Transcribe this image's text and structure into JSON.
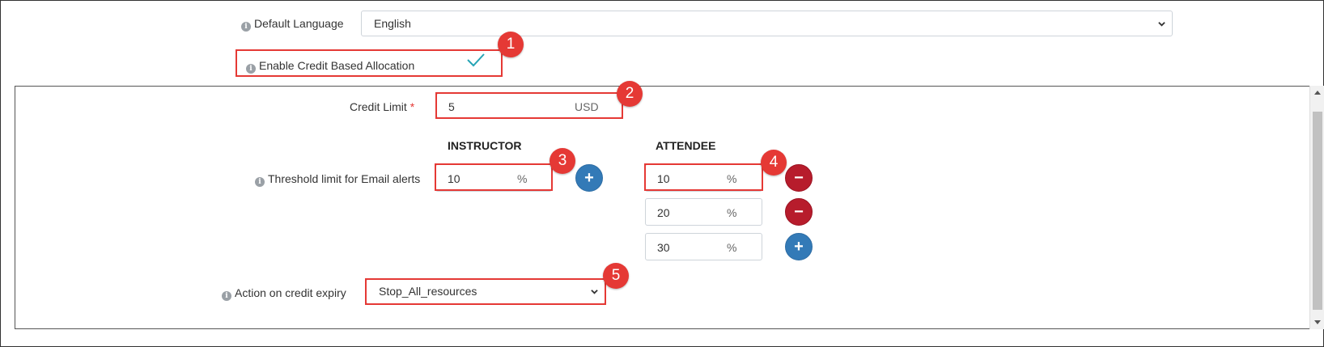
{
  "default_language": {
    "label": "Default Language",
    "value": "English"
  },
  "credit_allocation": {
    "label": "Enable Credit Based Allocation",
    "enabled": true
  },
  "credit_limit": {
    "label": "Credit Limit",
    "required_mark": "*",
    "value": "5",
    "unit": "USD"
  },
  "threshold": {
    "label": "Threshold limit for Email alerts",
    "instructor_header": "INSTRUCTOR",
    "attendee_header": "ATTENDEE",
    "instructor_value": "10",
    "attendee_values": [
      "10",
      "20",
      "30"
    ],
    "unit": "%",
    "add_symbol": "+",
    "remove_symbol": "−"
  },
  "credit_expiry": {
    "label": "Action on credit expiry",
    "value": "Stop_All_resources"
  },
  "callouts": [
    "1",
    "2",
    "3",
    "4",
    "5"
  ],
  "colors": {
    "highlight": "#e53935",
    "add_button": "#337ab7",
    "remove_button": "#b71c2c",
    "checkmark": "#26a4b5"
  }
}
